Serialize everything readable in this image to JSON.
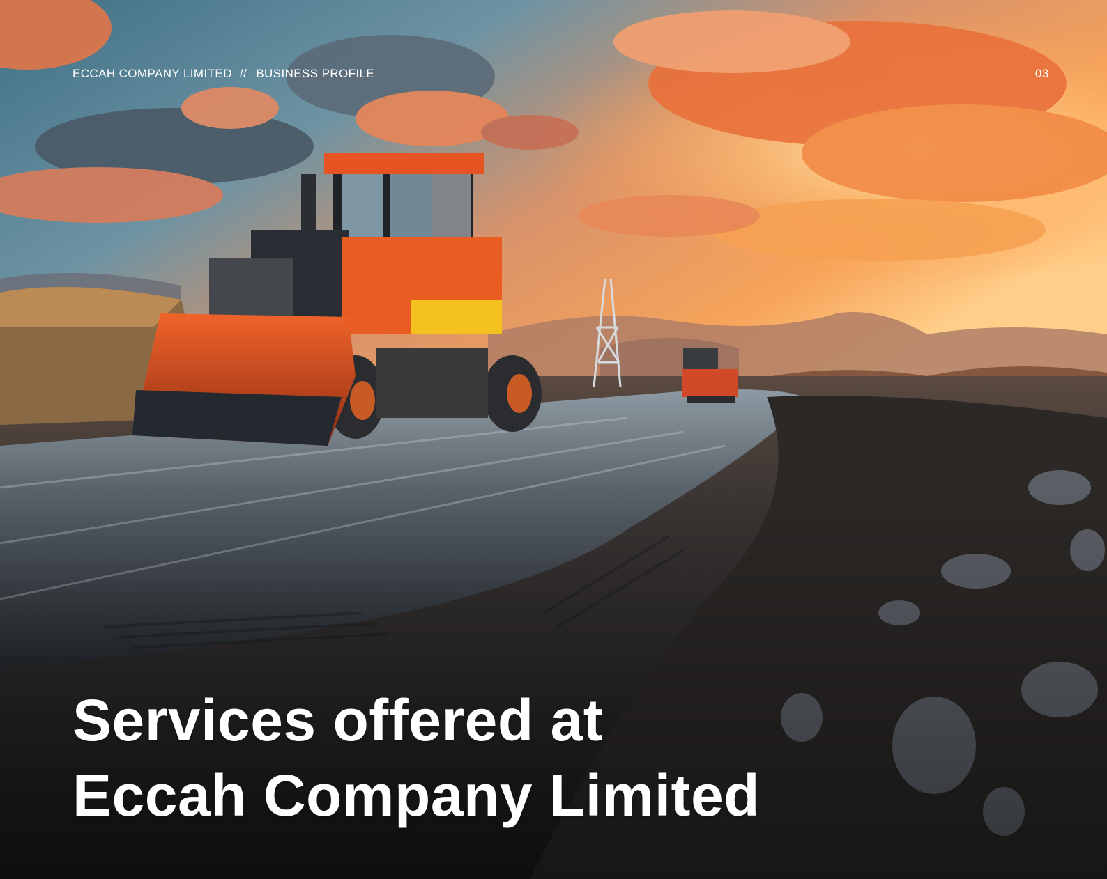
{
  "header": {
    "company": "ECCAH COMPANY LIMITED",
    "separator": "//",
    "section": "BUSINESS PROFILE",
    "page_number": "03"
  },
  "hero": {
    "title_line_1": "Services offered at",
    "title_line_2": "Eccah Company Limited"
  },
  "background": {
    "description_icon": "construction-site-photo-icon",
    "colors": {
      "sky_top": "#4f7f96",
      "sunset_orange": "#f38a3e",
      "sun_glow": "#ffd08a",
      "road_dark": "#2a2d31",
      "machine_orange": "#e2561f"
    }
  }
}
